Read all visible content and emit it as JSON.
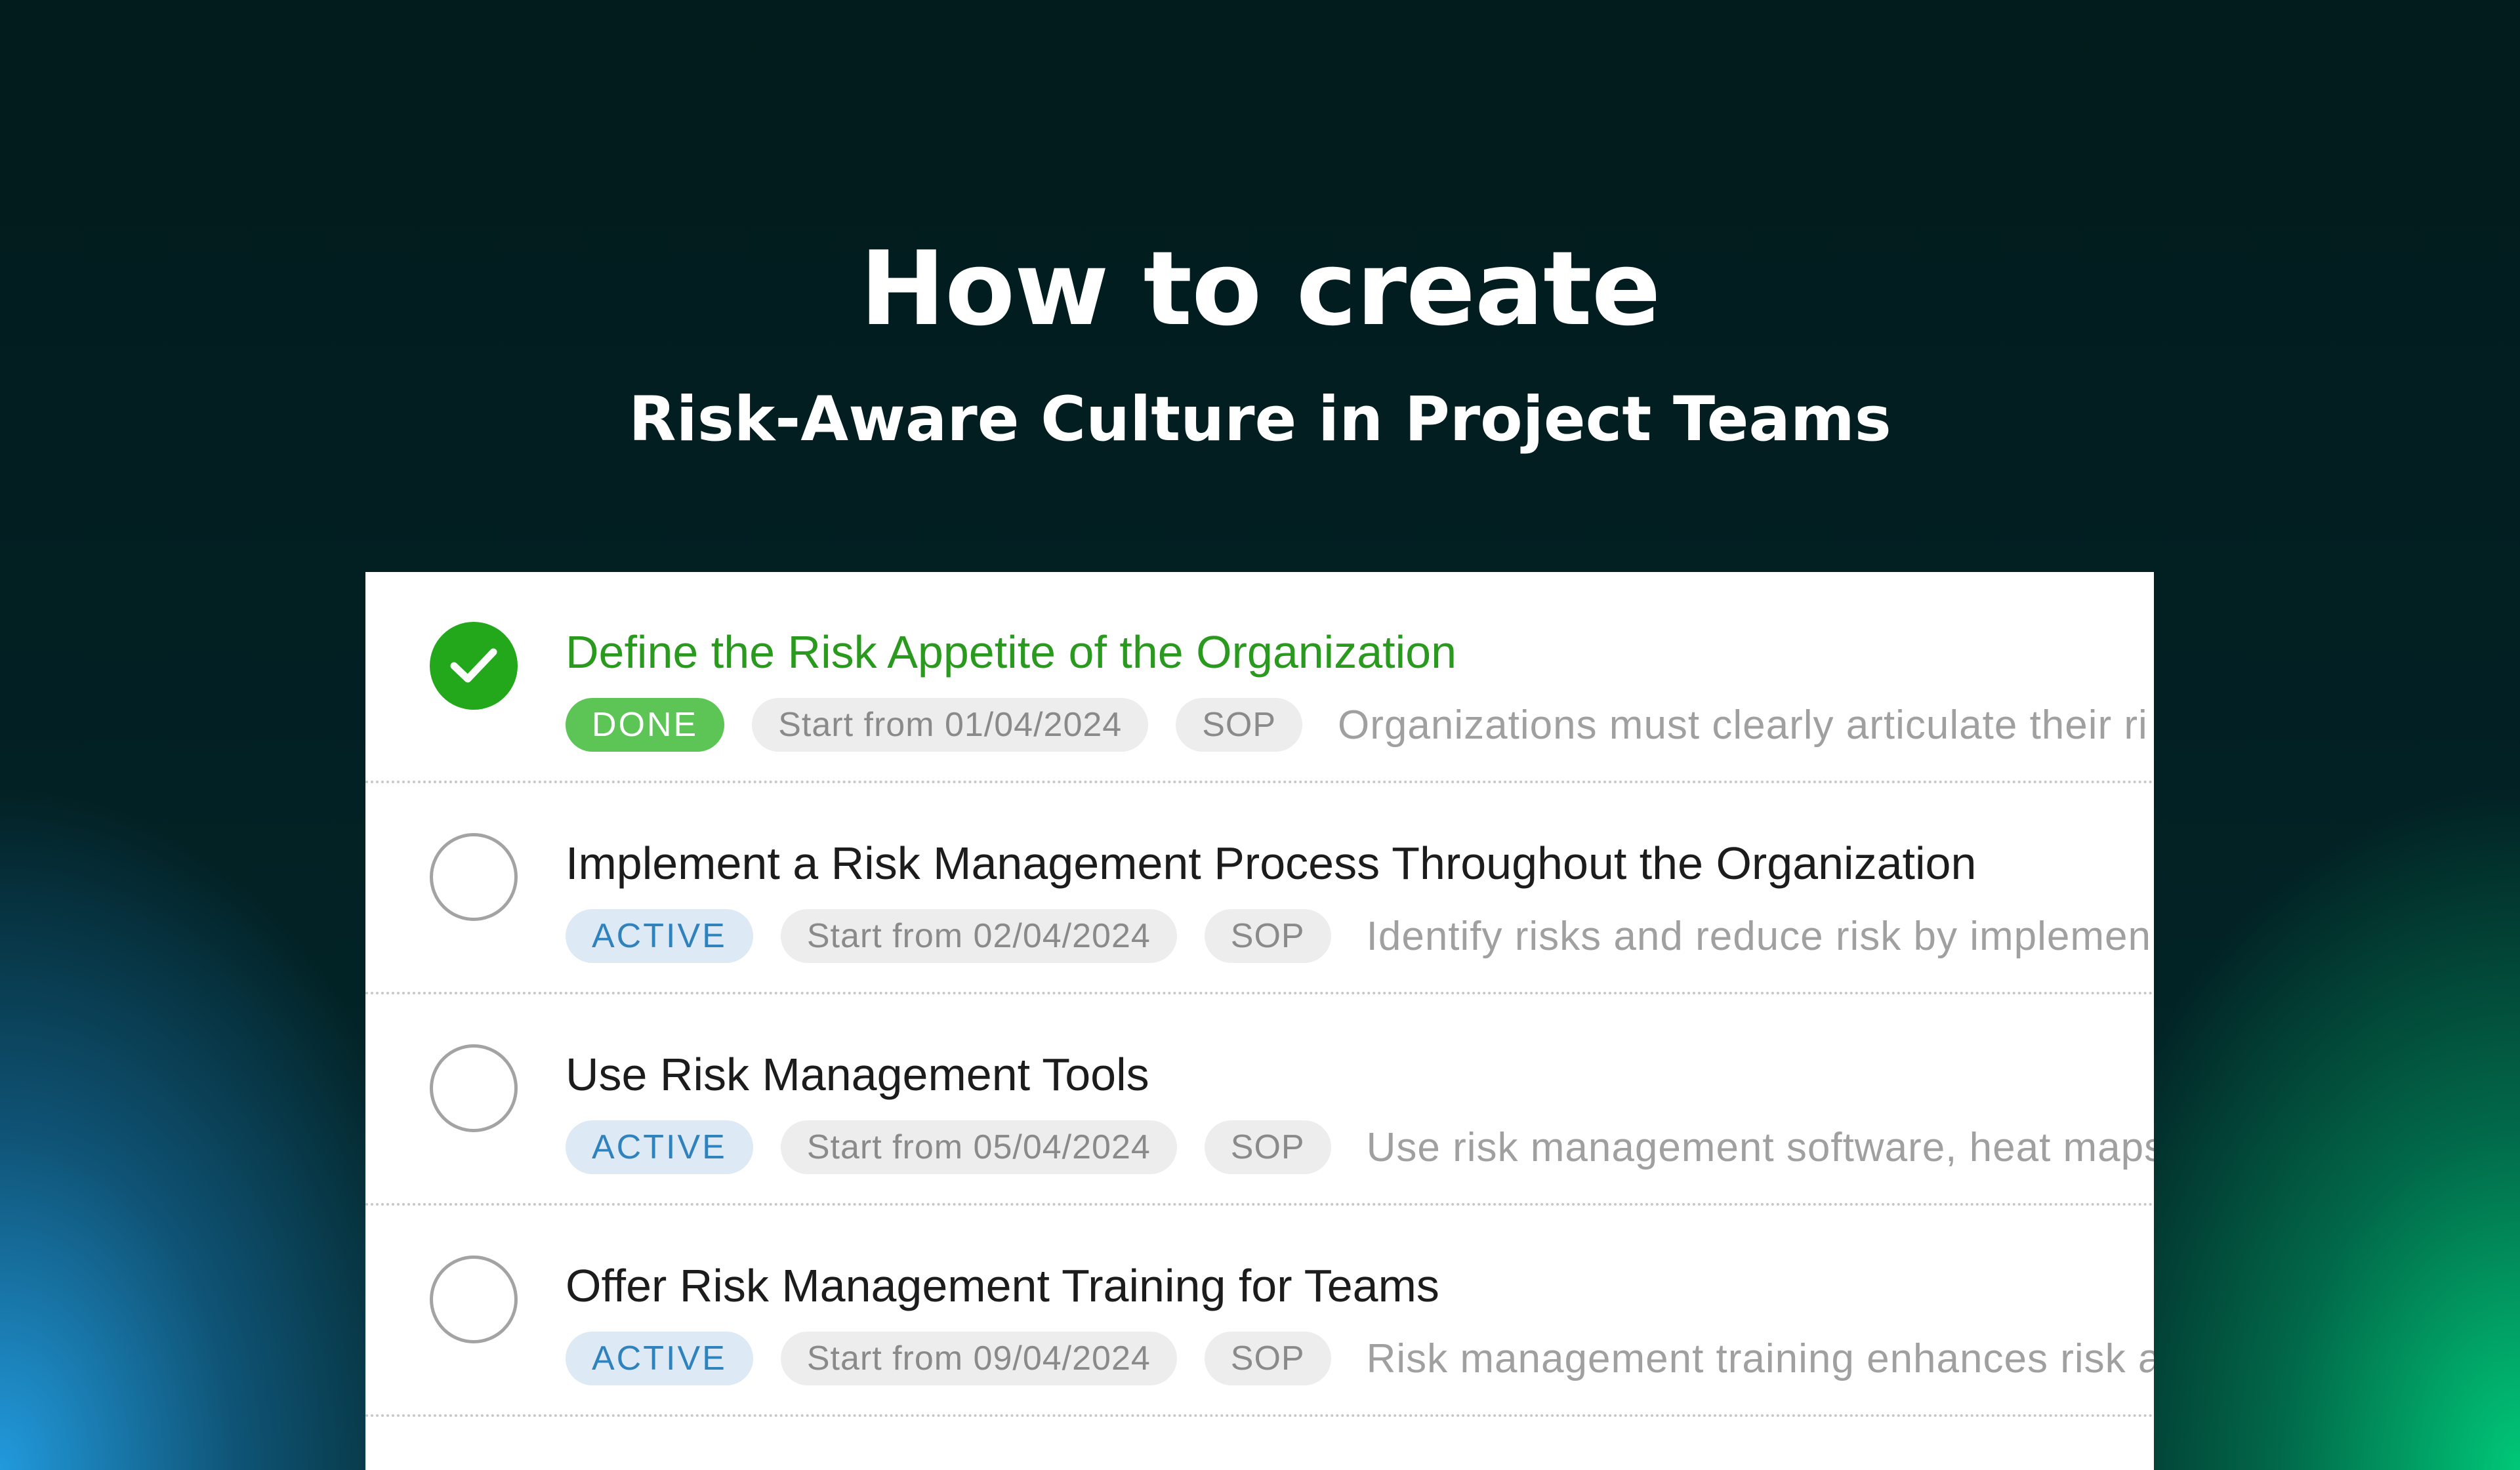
{
  "hero": {
    "title": "How to create",
    "subtitle": "Risk-Aware Culture in Project Teams"
  },
  "colors": {
    "done_green": "#22a81a",
    "active_blue": "#3082bd",
    "background_dark": "#021b1c"
  },
  "tasks": [
    {
      "title": "Define the Risk Appetite of the Organization",
      "status": "DONE",
      "completed": true,
      "start": "Start from 01/04/2024",
      "tag": "SOP",
      "description": "Organizations must clearly articulate their ri"
    },
    {
      "title": "Implement a Risk Management Process Throughout the Organization",
      "status": "ACTIVE",
      "completed": false,
      "start": "Start from 02/04/2024",
      "tag": "SOP",
      "description": "Identify risks and reduce risk by implemen"
    },
    {
      "title": "Use Risk Management Tools",
      "status": "ACTIVE",
      "completed": false,
      "start": "Start from 05/04/2024",
      "tag": "SOP",
      "description": "Use risk management software, heat maps"
    },
    {
      "title": "Offer Risk Management Training for Teams",
      "status": "ACTIVE",
      "completed": false,
      "start": "Start from 09/04/2024",
      "tag": "SOP",
      "description": "Risk management training enhances risk a"
    }
  ]
}
